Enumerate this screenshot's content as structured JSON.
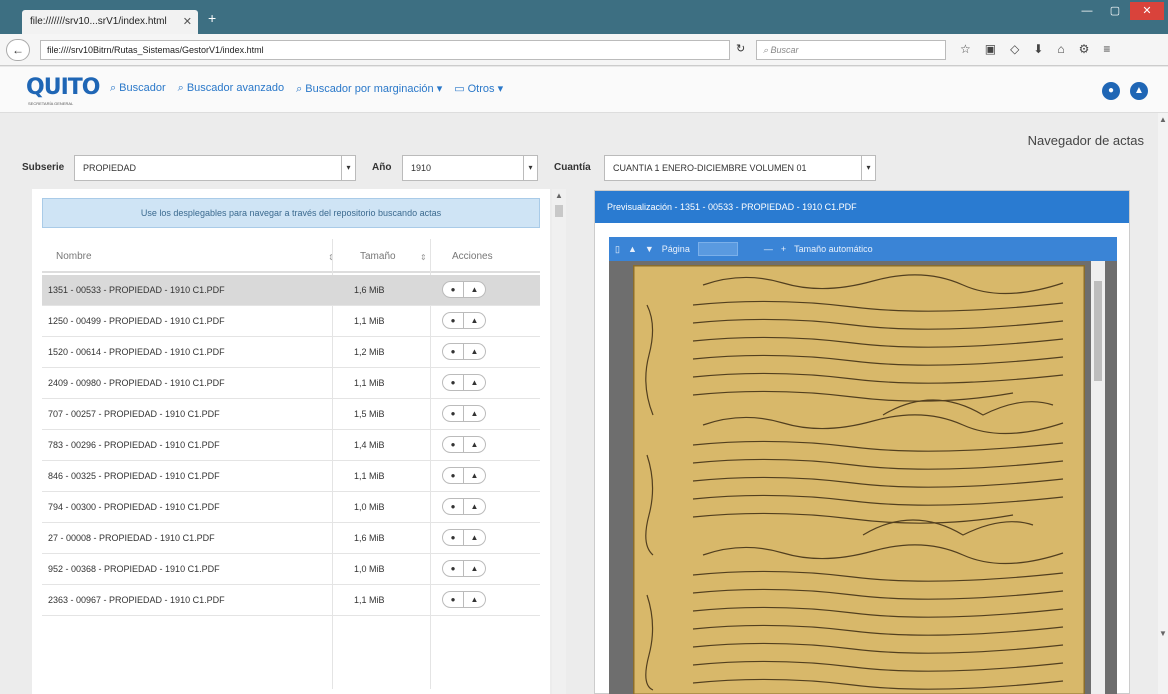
{
  "browser": {
    "tab_title": "file:///////srv10...srV1/index.html",
    "tab_close": "✕",
    "new_tab": "+",
    "url": "file:////srv10Bitrn/Rutas_Sistemas/GestorV1/index.html",
    "search_placeholder": "Buscar",
    "win_min": "—",
    "win_max": "▢",
    "win_close": "✕"
  },
  "app": {
    "logo": "QUITO",
    "logo_sub": "SECRETARÍA GENERAL",
    "menu": [
      {
        "icon": "⌕",
        "label": "Buscador"
      },
      {
        "icon": "⌕",
        "label": "Buscador avanzado"
      },
      {
        "icon": "⌕",
        "label": "Buscador por marginación ▾"
      },
      {
        "icon": "▭",
        "label": "Otros ▾"
      }
    ],
    "page_heading": "Navegador de actas"
  },
  "filters": {
    "subserie_label": "Subserie",
    "subserie_value": "PROPIEDAD",
    "anio_label": "Año",
    "anio_value": "1910",
    "cuantia_label": "Cuantía",
    "cuantia_value": "CUANTIA 1 ENERO-DICIEMBRE VOLUMEN 01"
  },
  "list": {
    "info": "Use los desplegables para navegar a través del repositorio buscando actas",
    "columns": {
      "name": "Nombre",
      "size": "Tamaño",
      "actions": "Acciones"
    },
    "sort_icon": "⇕",
    "view_icon": "●",
    "download_icon": "▲",
    "rows": [
      {
        "name": "1351 - 00533 - PROPIEDAD - 1910 C1.PDF",
        "size": "1,6 MiB"
      },
      {
        "name": "1250 - 00499 - PROPIEDAD - 1910 C1.PDF",
        "size": "1,1 MiB"
      },
      {
        "name": "1520 - 00614 - PROPIEDAD - 1910 C1.PDF",
        "size": "1,2 MiB"
      },
      {
        "name": "2409 - 00980 - PROPIEDAD - 1910 C1.PDF",
        "size": "1,1 MiB"
      },
      {
        "name": "707 - 00257 - PROPIEDAD - 1910 C1.PDF",
        "size": "1,5 MiB"
      },
      {
        "name": "783 - 00296 - PROPIEDAD - 1910 C1.PDF",
        "size": "1,4 MiB"
      },
      {
        "name": "846 - 00325 - PROPIEDAD - 1910 C1.PDF",
        "size": "1,1 MiB"
      },
      {
        "name": "794 - 00300 - PROPIEDAD - 1910 C1.PDF",
        "size": "1,0 MiB"
      },
      {
        "name": "27 - 00008 - PROPIEDAD - 1910 C1.PDF",
        "size": "1,6 MiB"
      },
      {
        "name": "952 - 00368 - PROPIEDAD - 1910 C1.PDF",
        "size": "1,0 MiB"
      },
      {
        "name": "2363 - 00967 - PROPIEDAD - 1910 C1.PDF",
        "size": "1,1 MiB"
      }
    ]
  },
  "preview": {
    "title": "Previsualización - 1351 - 00533 - PROPIEDAD - 1910 C1.PDF",
    "toolbar": {
      "page_label": "Página",
      "zoom_label": "Tamaño automático"
    }
  }
}
